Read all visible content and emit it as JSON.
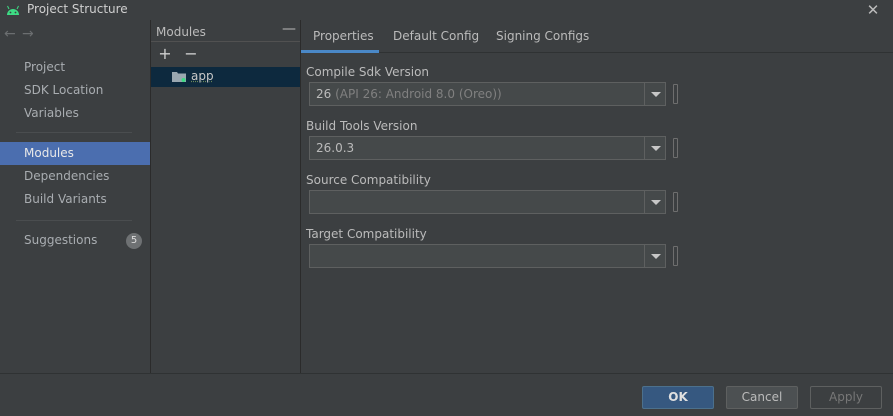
{
  "window": {
    "title": "Project Structure"
  },
  "nav": {
    "items": [
      {
        "label": "Project"
      },
      {
        "label": "SDK Location"
      },
      {
        "label": "Variables"
      },
      {
        "label": "Modules"
      },
      {
        "label": "Dependencies"
      },
      {
        "label": "Build Variants"
      },
      {
        "label": "Suggestions",
        "badge": "5"
      }
    ],
    "selected": "Modules"
  },
  "modules_panel": {
    "header": "Modules",
    "items": [
      {
        "label": "app"
      }
    ]
  },
  "tabs": [
    {
      "label": "Properties",
      "active": true
    },
    {
      "label": "Default Config",
      "active": false
    },
    {
      "label": "Signing Configs",
      "active": false
    }
  ],
  "fields": {
    "compile_sdk": {
      "label": "Compile Sdk Version",
      "value": "26",
      "hint": "(API 26: Android 8.0 (Oreo))"
    },
    "build_tools": {
      "label": "Build Tools Version",
      "value": "26.0.3"
    },
    "source_compat": {
      "label": "Source Compatibility",
      "value": ""
    },
    "target_compat": {
      "label": "Target Compatibility",
      "value": ""
    }
  },
  "buttons": {
    "ok": "OK",
    "cancel": "Cancel",
    "apply": "Apply"
  },
  "colors": {
    "accent": "#4b6eaf",
    "tab_underline": "#4a88c7",
    "android_green": "#3ddc84"
  }
}
